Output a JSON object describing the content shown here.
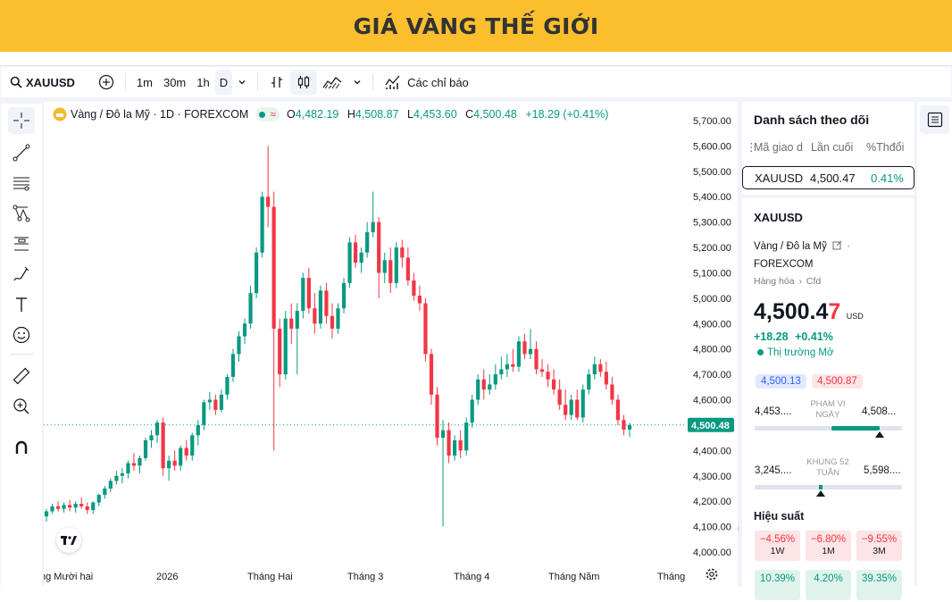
{
  "banner": {
    "title": "GIÁ VÀNG THẾ GIỚI"
  },
  "toolbar": {
    "symbol": "XAUUSD",
    "intervals": [
      "1m",
      "30m",
      "1h",
      "D"
    ],
    "indicators_label": "Các chỉ báo"
  },
  "legend": {
    "title": "Vàng / Đô la Mỹ · 1D · FOREXCOM",
    "o_key": "O",
    "o": "4,482.19",
    "h_key": "H",
    "h": "4,508.87",
    "l_key": "L",
    "l": "4,453.60",
    "c_key": "C",
    "c": "4,500.48",
    "change": "+18.29 (+0.41%)"
  },
  "colors": {
    "up": "#089981",
    "down": "#f23645",
    "banner": "#fbbf2e"
  },
  "price_axis": {
    "ticks": [
      "5,700.00",
      "5,600.00",
      "5,500.00",
      "5,400.00",
      "5,300.00",
      "5,200.00",
      "5,100.00",
      "5,000.00",
      "4,900.00",
      "4,800.00",
      "4,700.00",
      "4,600.00",
      "4,500.00",
      "4,400.00",
      "4,300.00",
      "4,200.00",
      "4,100.00",
      "4,000.00"
    ],
    "last_price_label": "4,500.48"
  },
  "time_axis": {
    "labels": [
      "ng Mười hai",
      "2026",
      "Tháng Hai",
      "Tháng 3",
      "Tháng 4",
      "Tháng Năm",
      "Tháng"
    ]
  },
  "chart_data": {
    "type": "candlestick",
    "symbol": "XAUUSD",
    "interval": "1D",
    "ylim": [
      4000,
      5700
    ],
    "candles": [
      [
        4140,
        4170,
        4120,
        4160
      ],
      [
        4160,
        4190,
        4150,
        4180
      ],
      [
        4180,
        4200,
        4160,
        4170
      ],
      [
        4170,
        4195,
        4155,
        4185
      ],
      [
        4185,
        4205,
        4160,
        4175
      ],
      [
        4175,
        4200,
        4155,
        4190
      ],
      [
        4190,
        4215,
        4170,
        4180
      ],
      [
        4180,
        4195,
        4150,
        4165
      ],
      [
        4165,
        4200,
        4150,
        4195
      ],
      [
        4195,
        4230,
        4180,
        4225
      ],
      [
        4225,
        4260,
        4210,
        4250
      ],
      [
        4250,
        4290,
        4235,
        4280
      ],
      [
        4280,
        4320,
        4265,
        4300
      ],
      [
        4300,
        4330,
        4270,
        4310
      ],
      [
        4310,
        4360,
        4290,
        4350
      ],
      [
        4350,
        4390,
        4320,
        4340
      ],
      [
        4340,
        4380,
        4310,
        4370
      ],
      [
        4370,
        4450,
        4360,
        4440
      ],
      [
        4440,
        4480,
        4410,
        4460
      ],
      [
        4460,
        4520,
        4430,
        4510
      ],
      [
        4510,
        4530,
        4300,
        4330
      ],
      [
        4330,
        4380,
        4280,
        4360
      ],
      [
        4360,
        4400,
        4320,
        4340
      ],
      [
        4340,
        4420,
        4320,
        4410
      ],
      [
        4410,
        4440,
        4360,
        4380
      ],
      [
        4380,
        4470,
        4360,
        4460
      ],
      [
        4460,
        4520,
        4420,
        4500
      ],
      [
        4500,
        4600,
        4480,
        4590
      ],
      [
        4590,
        4630,
        4560,
        4600
      ],
      [
        4600,
        4620,
        4540,
        4560
      ],
      [
        4560,
        4640,
        4550,
        4620
      ],
      [
        4620,
        4700,
        4600,
        4690
      ],
      [
        4690,
        4800,
        4670,
        4780
      ],
      [
        4780,
        4870,
        4750,
        4850
      ],
      [
        4850,
        4920,
        4820,
        4900
      ],
      [
        4900,
        5050,
        4880,
        5020
      ],
      [
        5020,
        5200,
        5000,
        5180
      ],
      [
        5180,
        5420,
        5160,
        5400
      ],
      [
        5400,
        5600,
        5280,
        5360
      ],
      [
        5360,
        5420,
        4400,
        4880
      ],
      [
        4880,
        4920,
        4650,
        4700
      ],
      [
        4700,
        4950,
        4680,
        4920
      ],
      [
        4920,
        4980,
        4820,
        4880
      ],
      [
        4880,
        4980,
        4700,
        4950
      ],
      [
        4950,
        5100,
        4920,
        5080
      ],
      [
        5080,
        5120,
        4940,
        4960
      ],
      [
        4960,
        5020,
        4860,
        4900
      ],
      [
        4900,
        5050,
        4880,
        5030
      ],
      [
        5030,
        5060,
        4900,
        4930
      ],
      [
        4930,
        4980,
        4840,
        4880
      ],
      [
        4880,
        4980,
        4860,
        4960
      ],
      [
        4960,
        5080,
        4940,
        5060
      ],
      [
        5060,
        5240,
        5040,
        5220
      ],
      [
        5220,
        5250,
        5120,
        5140
      ],
      [
        5140,
        5200,
        5100,
        5180
      ],
      [
        5180,
        5300,
        5160,
        5260
      ],
      [
        5260,
        5420,
        5240,
        5300
      ],
      [
        5300,
        5320,
        5000,
        5100
      ],
      [
        5100,
        5180,
        5060,
        5150
      ],
      [
        5150,
        5200,
        5020,
        5060
      ],
      [
        5060,
        5220,
        5040,
        5200
      ],
      [
        5200,
        5230,
        5120,
        5160
      ],
      [
        5160,
        5200,
        5050,
        5070
      ],
      [
        5070,
        5100,
        4990,
        5010
      ],
      [
        5010,
        5050,
        4950,
        4980
      ],
      [
        4980,
        5000,
        4750,
        4780
      ],
      [
        4780,
        4800,
        4580,
        4620
      ],
      [
        4620,
        4650,
        4420,
        4450
      ],
      [
        4450,
        4520,
        4100,
        4480
      ],
      [
        4480,
        4510,
        4350,
        4380
      ],
      [
        4380,
        4460,
        4360,
        4440
      ],
      [
        4440,
        4480,
        4370,
        4400
      ],
      [
        4400,
        4530,
        4380,
        4510
      ],
      [
        4510,
        4620,
        4490,
        4600
      ],
      [
        4600,
        4700,
        4580,
        4680
      ],
      [
        4680,
        4720,
        4600,
        4640
      ],
      [
        4640,
        4700,
        4620,
        4660
      ],
      [
        4660,
        4740,
        4640,
        4700
      ],
      [
        4700,
        4770,
        4680,
        4720
      ],
      [
        4720,
        4780,
        4690,
        4740
      ],
      [
        4740,
        4800,
        4710,
        4730
      ],
      [
        4730,
        4850,
        4710,
        4830
      ],
      [
        4830,
        4860,
        4760,
        4780
      ],
      [
        4780,
        4880,
        4760,
        4800
      ],
      [
        4800,
        4830,
        4700,
        4720
      ],
      [
        4720,
        4760,
        4690,
        4710
      ],
      [
        4710,
        4740,
        4650,
        4680
      ],
      [
        4680,
        4720,
        4620,
        4640
      ],
      [
        4640,
        4680,
        4560,
        4580
      ],
      [
        4580,
        4640,
        4520,
        4540
      ],
      [
        4540,
        4620,
        4520,
        4600
      ],
      [
        4600,
        4640,
        4520,
        4530
      ],
      [
        4530,
        4660,
        4510,
        4640
      ],
      [
        4640,
        4720,
        4620,
        4700
      ],
      [
        4700,
        4770,
        4680,
        4740
      ],
      [
        4740,
        4760,
        4690,
        4710
      ],
      [
        4710,
        4750,
        4640,
        4660
      ],
      [
        4660,
        4690,
        4580,
        4600
      ],
      [
        4600,
        4620,
        4500,
        4520
      ],
      [
        4520,
        4540,
        4460,
        4482
      ],
      [
        4482.19,
        4508.87,
        4453.6,
        4500.48
      ]
    ]
  },
  "watchlist": {
    "title": "Danh sách theo dõi",
    "columns": [
      "Mã giao d",
      "Lần cuối",
      "%Thđổi"
    ],
    "rows": [
      {
        "symbol": "XAUUSD",
        "last": "4,500.47",
        "change": "0.41%"
      }
    ]
  },
  "details": {
    "symbol": "XAUUSD",
    "name": "Vàng / Đô la Mỹ",
    "exchange_sep": "·",
    "exchange": "FOREXCOM",
    "category": "Hàng hóa",
    "type": "Cfd",
    "price_main": "4,500.4",
    "price_last_digit": "7",
    "currency": "USD",
    "change": "+18.28",
    "change_pct": "+0.41%",
    "market_status": "Thị trường Mở",
    "bid": "4,500.13",
    "ask": "4,500.87",
    "day_low": "4,453....",
    "day_high": "4,508...",
    "day_range_label_1": "PHẠM VI",
    "day_range_label_2": "NGÀY",
    "day_range_fraction": 0.85,
    "week52_low": "3,245....",
    "week52_high": "5,598....",
    "week52_label_1": "KHUNG 52",
    "week52_label_2": "TUẦN",
    "week52_fraction": 0.45
  },
  "performance": {
    "title": "Hiệu suất",
    "items": [
      {
        "value": "−4.56%",
        "label": "1W",
        "trend": "down"
      },
      {
        "value": "−6.80%",
        "label": "1M",
        "trend": "down"
      },
      {
        "value": "−9.55%",
        "label": "3M",
        "trend": "down"
      },
      {
        "value": "10.39%",
        "label": "",
        "trend": "up"
      },
      {
        "value": "4.20%",
        "label": "",
        "trend": "up"
      },
      {
        "value": "39.35%",
        "label": "",
        "trend": "up"
      }
    ]
  }
}
